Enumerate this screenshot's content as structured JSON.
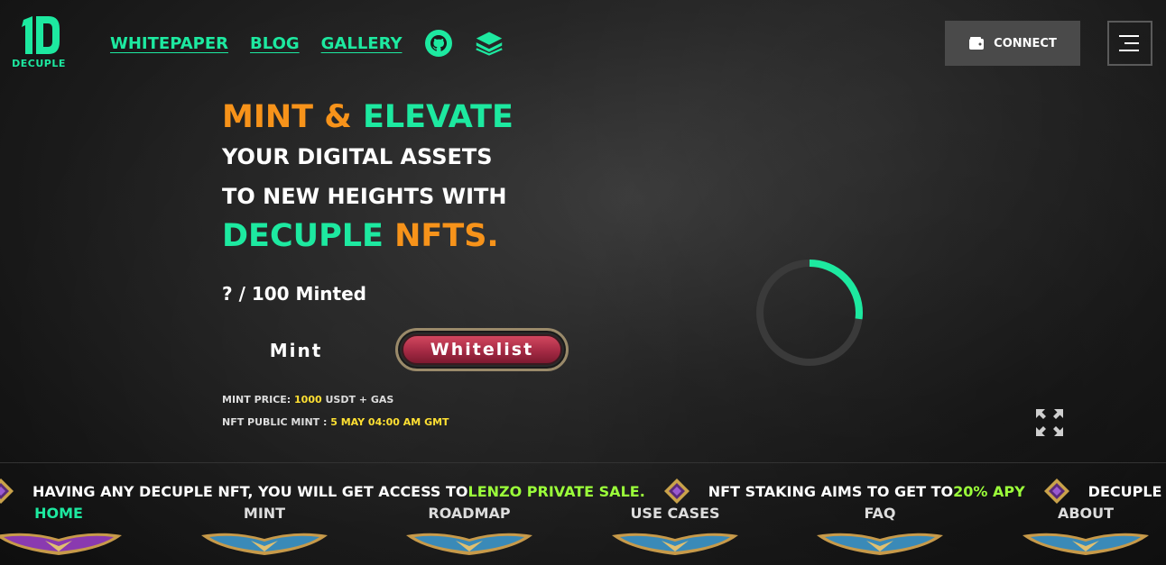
{
  "header": {
    "logo_text": "DECUPLE",
    "nav": [
      {
        "label": "WHITEPAPER"
      },
      {
        "label": "BLOG"
      },
      {
        "label": "GALLERY"
      }
    ],
    "icons": [
      "github-icon",
      "layers-icon"
    ],
    "connect_label": "CONNECT"
  },
  "hero": {
    "line1_a": "MINT",
    "line1_b": "&",
    "line1_c": "ELEVATE",
    "line2": "YOUR DIGITAL ASSETS",
    "line3": "TO NEW HEIGHTS WITH",
    "line4_a": "DECUPLE",
    "line4_b": "NFTS.",
    "minted": "? / 100 Minted",
    "mint_label": "Mint",
    "whitelist_label": "Whitelist",
    "price_label": "MINT PRICE: ",
    "price_value": "1000",
    "price_suffix": " USDT + GAS",
    "public_label": "NFT PUBLIC MINT : ",
    "public_value": "5 MAY 04:00 AM GMT"
  },
  "loader": {
    "progress": 0.27,
    "accent": "#1de9a0"
  },
  "ticker": {
    "items": [
      {
        "pre": "HAVING ANY DECUPLE NFT, YOU WILL GET ACCESS TO ",
        "hl": "LENZO PRIVATE SALE."
      },
      {
        "pre": "NFT STAKING AIMS TO GET TO ",
        "hl": "20% APY"
      },
      {
        "pre": "DECUPLE REFE",
        "hl": ""
      }
    ]
  },
  "bottom_nav": [
    {
      "label": "HOME",
      "active": true
    },
    {
      "label": "MINT",
      "active": false
    },
    {
      "label": "ROADMAP",
      "active": false
    },
    {
      "label": "USE CASES",
      "active": false
    },
    {
      "label": "FAQ",
      "active": false
    },
    {
      "label": "ABOUT",
      "active": false
    }
  ],
  "colors": {
    "accent": "#1de9a0",
    "orange": "#f7931a",
    "highlight": "#9bff3a",
    "yellow": "#ffe033"
  }
}
